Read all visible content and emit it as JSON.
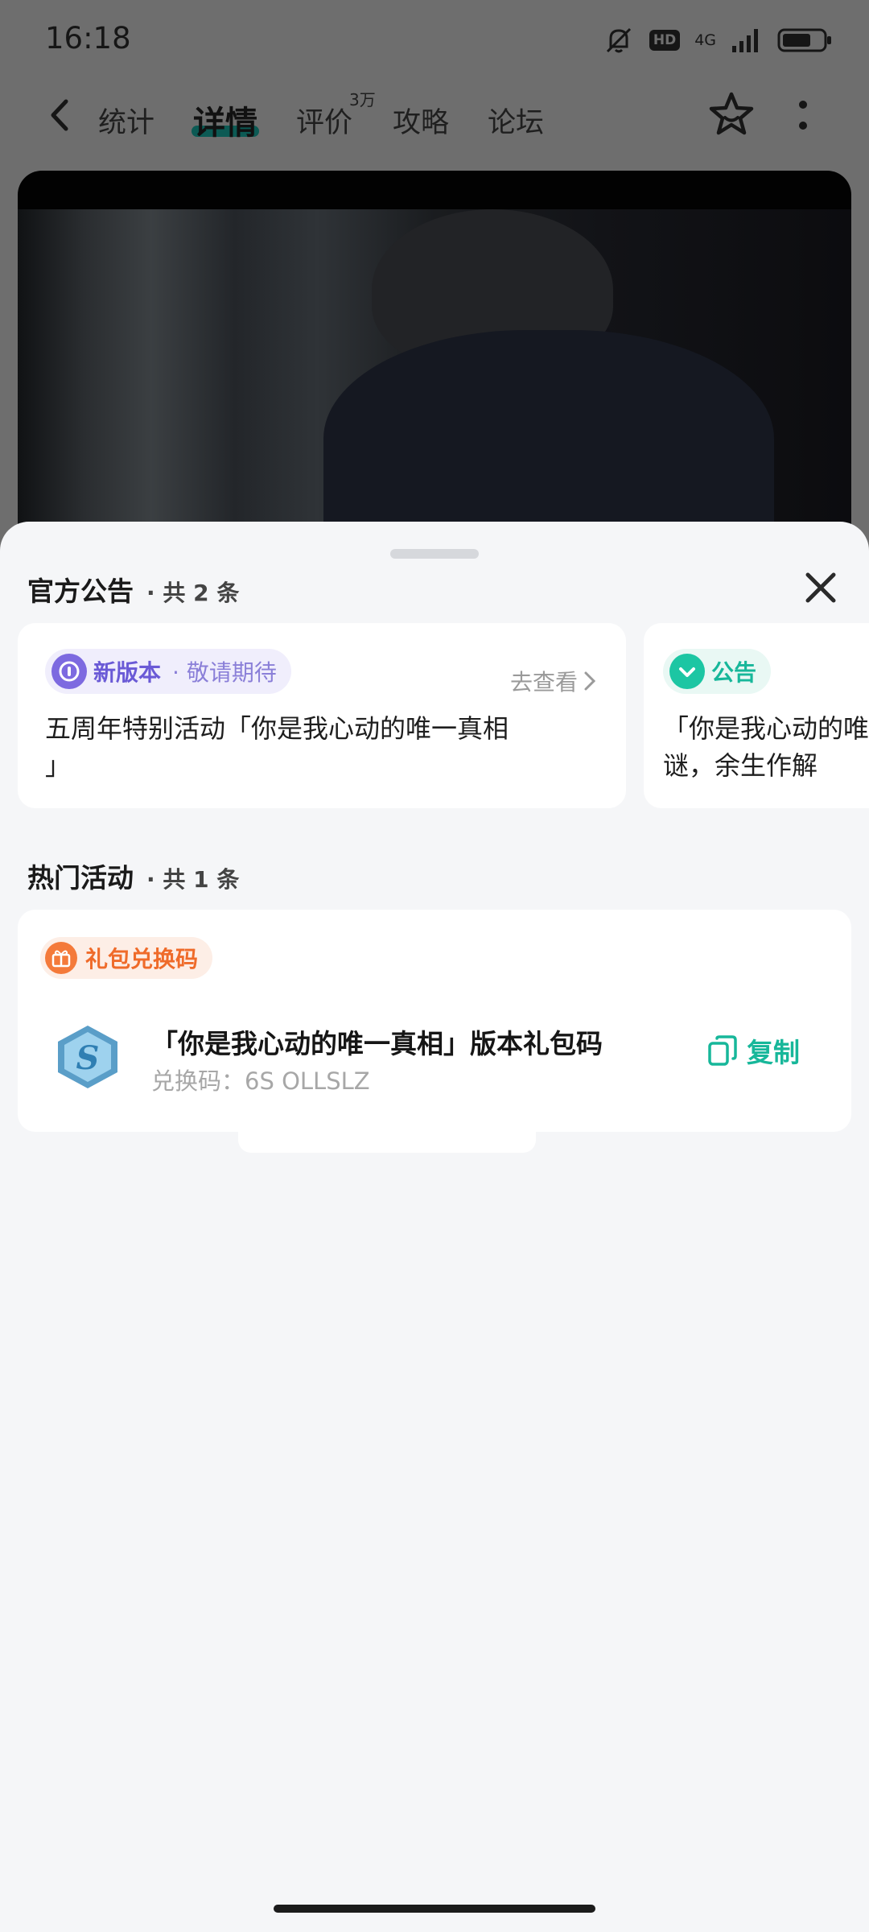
{
  "status_bar": {
    "time": "16:18",
    "hd_label": "HD",
    "network": "4G"
  },
  "nav": {
    "tabs": [
      {
        "label": "统计"
      },
      {
        "label": "详情"
      },
      {
        "label": "评价",
        "badge": "3万"
      },
      {
        "label": "攻略"
      },
      {
        "label": "论坛"
      }
    ],
    "active_tab": "详情"
  },
  "sheet": {
    "announcements": {
      "title": "官方公告",
      "count": "· 共 2 条",
      "items": [
        {
          "tag": "新版本",
          "sub": "· 敬请期待",
          "link": "去查看",
          "text_line1": "五周年特别活动「你是我心动的唯一真相",
          "text_line2": "」"
        },
        {
          "tag": "公告",
          "text_line1": "「你是我心动的唯",
          "text_line2": "谜，余生作解"
        }
      ]
    },
    "activities": {
      "title": "热门活动",
      "count": "· 共 1 条",
      "gift": {
        "tag": "礼包兑换码",
        "title": "「你是我心动的唯一真相」版本礼包码",
        "code": "兑换码：6S       OLLSLZ",
        "copy_label": "复制"
      }
    }
  },
  "colors": {
    "accent_green": "#17b79a",
    "accent_purple": "#6a5ad6",
    "accent_orange": "#ef6b2a",
    "tab_underline": "#0c5a54"
  }
}
